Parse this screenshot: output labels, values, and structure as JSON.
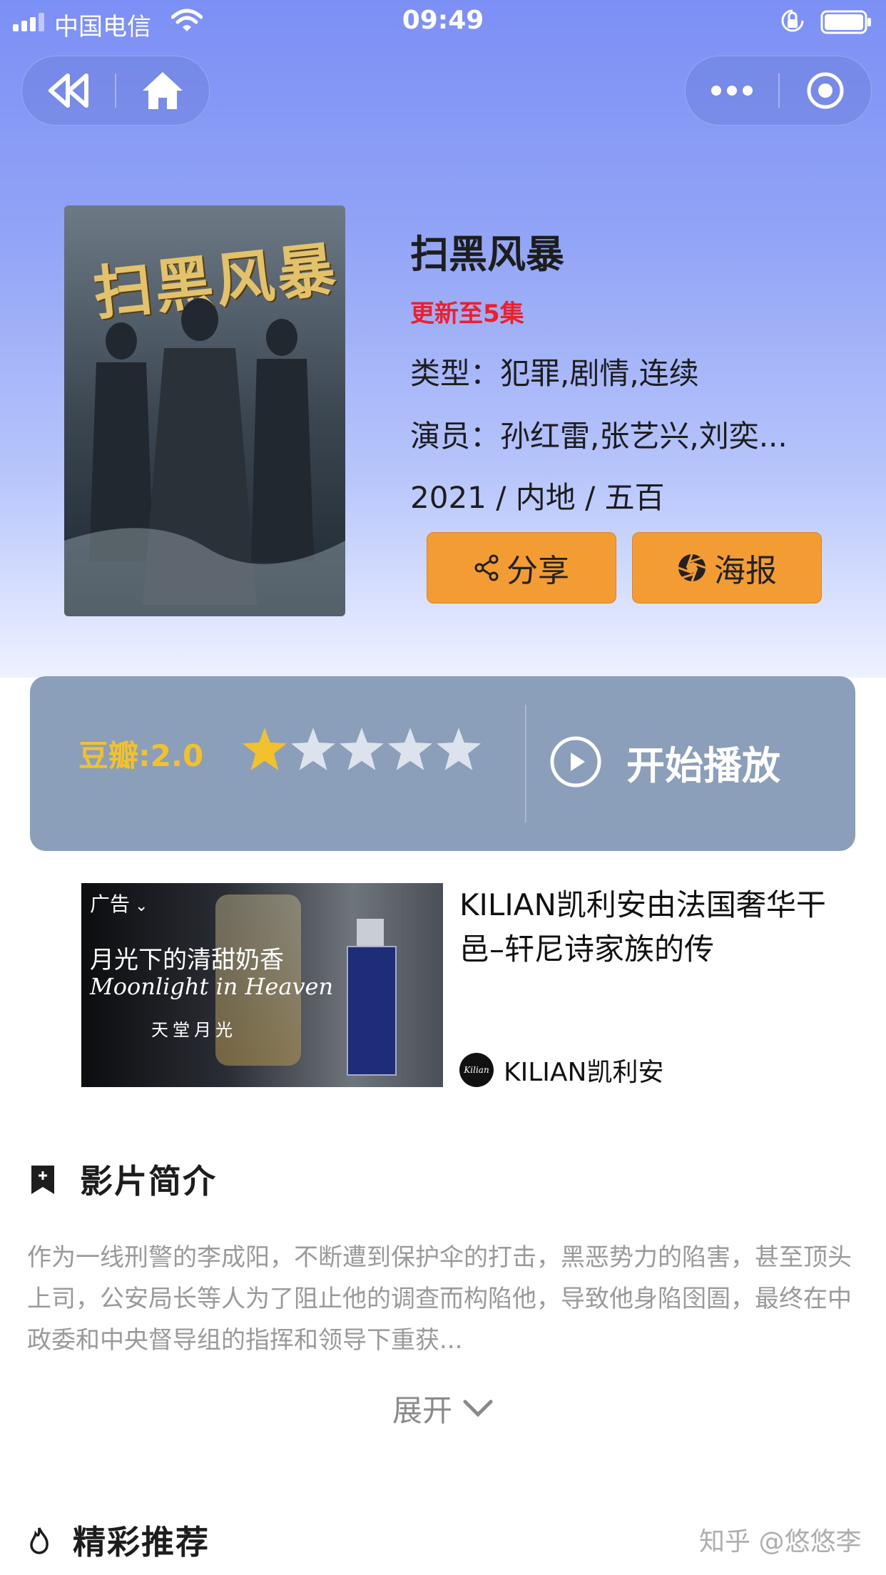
{
  "status_bar": {
    "carrier": "中国电信",
    "time": "09:49"
  },
  "movie": {
    "title": "扫黑风暴",
    "poster_title": "扫黑风暴",
    "update": "更新至5集",
    "genre": "类型：犯罪,剧情,连续",
    "cast": "演员：孙红雷,张艺兴,刘奕...",
    "meta": "2021 / 内地 / 五百"
  },
  "actions": {
    "share_label": "分享",
    "poster_label": "海报"
  },
  "rating": {
    "label": "豆瓣:2.0",
    "score": 2.0,
    "stars_filled": 1,
    "stars_total": 5,
    "play_label": "开始播放"
  },
  "ad": {
    "tag": "广告",
    "image_line1": "月光下的清甜奶香",
    "image_line2": "Moonlight in Heaven",
    "image_line3": "天堂月光",
    "text": "KILIAN凯利安由法国奢华干邑–轩尼诗家族的传",
    "brand": "KILIAN凯利安",
    "logo_text": "Kilian"
  },
  "synopsis": {
    "heading": "影片简介",
    "text": "作为一线刑警的李成阳，不断遭到保护伞的打击，黑恶势力的陷害，甚至顶头上司，公安局长等人为了阻止他的调查而构陷他，导致他身陷囹圄，最终在中政委和中央督导组的指挥和领导下重获...",
    "expand_label": "展开"
  },
  "recommend": {
    "heading": "精彩推荐"
  },
  "watermark": "知乎 @悠悠李",
  "colors": {
    "header": "#7c8ff5",
    "accent_orange": "#f39c33",
    "update_red": "#ee1f2a",
    "star": "#f2c12e",
    "card": "#8b9fbb"
  }
}
